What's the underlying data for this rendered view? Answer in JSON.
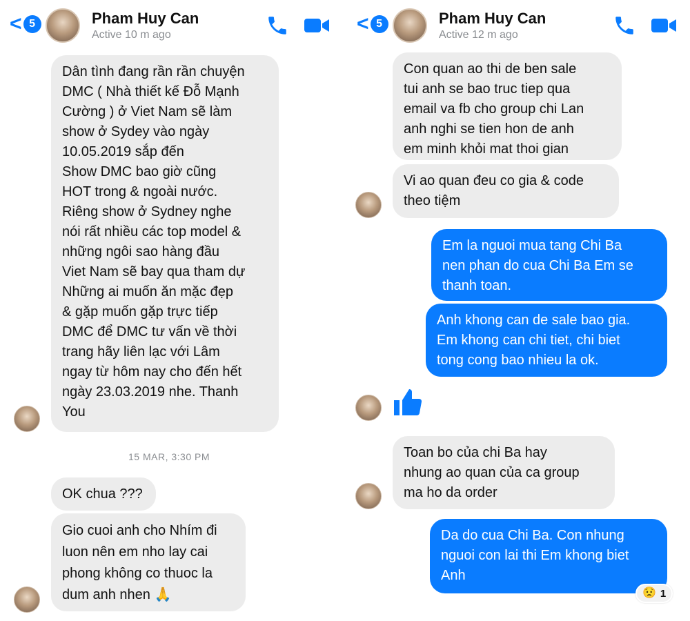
{
  "left_panel": {
    "header": {
      "back_count": "5",
      "contact_name": "Pham Huy Can",
      "status": "Active 10 m ago"
    },
    "messages": [
      {
        "lines": [
          "Dân tình đang rần rần chuyện",
          "DMC ( Nhà thiết kế Đỗ Mạnh",
          "Cường ) ở Viet Nam sẽ làm",
          "show ở Sydey vào ngày",
          "10.05.2019 sắp đến",
          "Show DMC bao giờ cũng",
          "HOT trong & ngoài nước.",
          "Riêng show ở Sydney nghe",
          "nói rất nhiều các top model &",
          "những ngôi sao hàng đầu",
          "Viet Nam sẽ bay qua tham dự",
          "Những ai muốn ăn mặc đẹp",
          "& gặp muốn gặp trực tiếp",
          "DMC để DMC tư vấn về thời",
          "trang hãy liên lạc với Lâm",
          "ngay từ hôm nay cho đến hết",
          "ngày 23.03.2019 nhe. Thanh",
          "You"
        ]
      },
      {
        "lines": [
          "OK chua ???"
        ]
      },
      {
        "lines": [
          "Gio cuoi anh cho Nhím đi",
          "luon nên em nho lay cai",
          "phong không co thuoc la",
          "dum anh nhen 🙏"
        ]
      }
    ],
    "timestamp": "15 MAR, 3:30 PM"
  },
  "right_panel": {
    "header": {
      "back_count": "5",
      "contact_name": "Pham Huy Can",
      "status": "Active 12 m ago"
    },
    "messages": [
      {
        "lines": [
          "Con quan ao thi de ben sale",
          "tui anh se bao truc tiep qua",
          "email va fb cho group chi Lan",
          "anh nghi se tien hon de anh",
          "em minh khỏi mat thoi gian"
        ]
      },
      {
        "lines": [
          "Vi ao quan đeu co gia & code",
          "theo tiệm"
        ]
      },
      {
        "lines": [
          "Em la nguoi mua tang Chi Ba",
          "nen phan do cua Chi Ba Em se",
          "thanh toan."
        ]
      },
      {
        "lines": [
          "Anh khong can de sale bao gia.",
          "Em khong can chi tiet, chi biet",
          "tong cong bao nhieu la ok."
        ]
      },
      {
        "lines": [
          "Toan bo của chi Ba hay",
          "nhung ao quan của ca group",
          "ma ho da order"
        ]
      },
      {
        "lines": [
          "Da do cua Chi Ba. Con nhung",
          "nguoi con lai thi Em khong biet",
          "Anh"
        ]
      }
    ],
    "reaction": {
      "emoji": "😟",
      "count": "1"
    }
  },
  "colors": {
    "accent": "#0a7cff",
    "incoming_bubble": "#ececec",
    "muted_text": "#8a8d91"
  },
  "icons": [
    "back-chevron-icon",
    "phone-icon",
    "video-camera-icon",
    "like-thumb-icon"
  ]
}
